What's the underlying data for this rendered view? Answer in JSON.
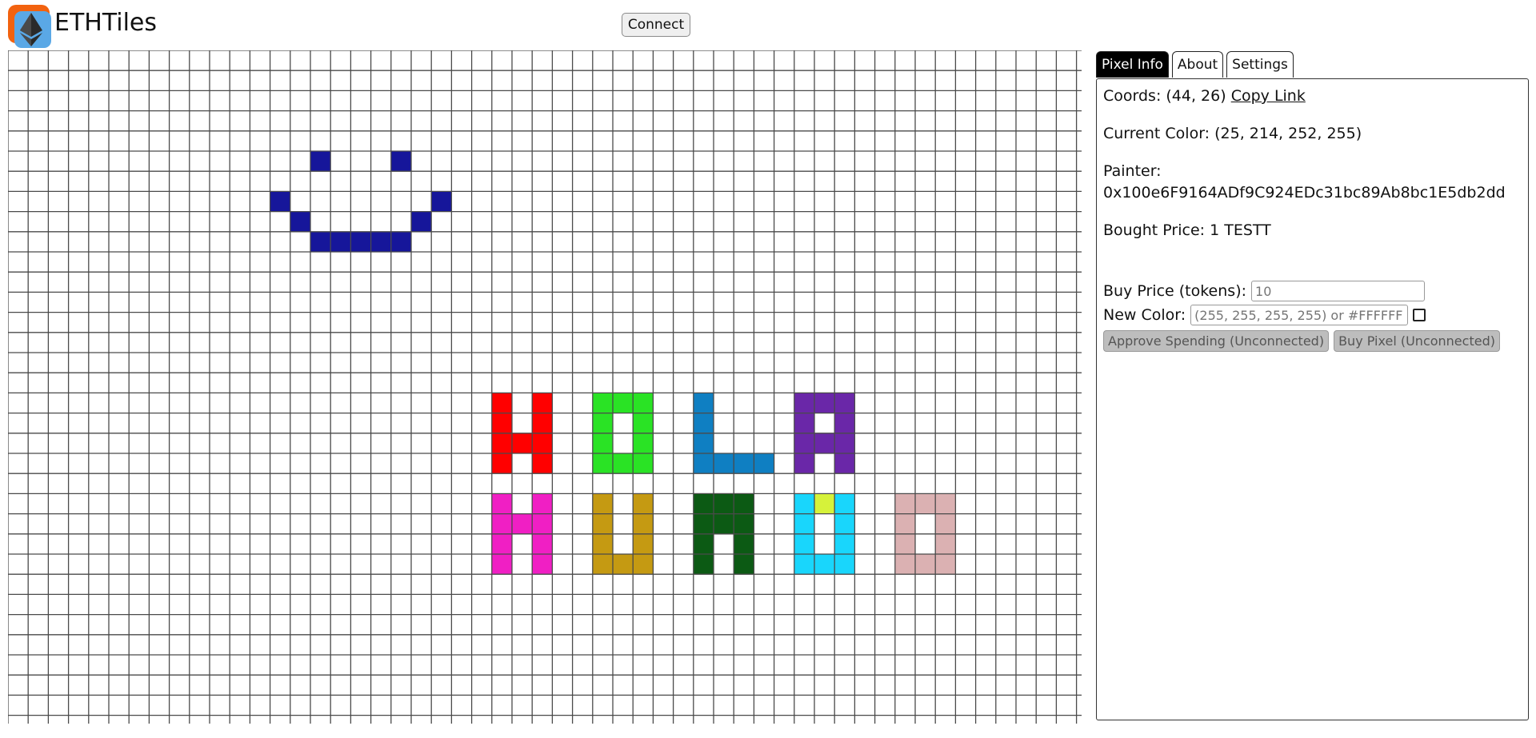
{
  "app": {
    "title": "ETHTiles"
  },
  "header": {
    "connect_label": "Connect"
  },
  "tabs": [
    {
      "label": "Pixel Info",
      "active": true
    },
    {
      "label": "About",
      "active": false
    },
    {
      "label": "Settings",
      "active": false
    }
  ],
  "pixel_info": {
    "coords_label": "Coords: (44, 26)",
    "copy_link_label": "Copy Link",
    "current_color": "Current Color: (25, 214, 252, 255)",
    "painter_label": "Painter:",
    "painter_address": "0x100e6F9164ADf9C924EDc31bc89Ab8bc1E5db2dd",
    "bought_price": "Bought Price: 1 TESTT"
  },
  "buy_form": {
    "price_label": "Buy Price (tokens):",
    "price_placeholder": "10",
    "color_label": "New Color:",
    "color_placeholder": "(255, 255, 255, 255) or #FFFFFFFF",
    "approve_label": "Approve Spending (Unconnected)",
    "buy_label": "Buy Pixel (Unconnected)"
  },
  "canvas": {
    "columns": 54,
    "rows": 34,
    "painted_pixels": [
      {
        "x": 15,
        "y": 5,
        "color": "#16169a"
      },
      {
        "x": 19,
        "y": 5,
        "color": "#16169a"
      },
      {
        "x": 13,
        "y": 7,
        "color": "#16169a"
      },
      {
        "x": 21,
        "y": 7,
        "color": "#16169a"
      },
      {
        "x": 14,
        "y": 8,
        "color": "#16169a"
      },
      {
        "x": 20,
        "y": 8,
        "color": "#16169a"
      },
      {
        "x": 15,
        "y": 9,
        "color": "#16169a"
      },
      {
        "x": 16,
        "y": 9,
        "color": "#16169a"
      },
      {
        "x": 17,
        "y": 9,
        "color": "#16169a"
      },
      {
        "x": 18,
        "y": 9,
        "color": "#16169a"
      },
      {
        "x": 19,
        "y": 9,
        "color": "#16169a"
      },
      {
        "x": 24,
        "y": 17,
        "color": "#ff0000"
      },
      {
        "x": 26,
        "y": 17,
        "color": "#ff0000"
      },
      {
        "x": 24,
        "y": 18,
        "color": "#ff0000"
      },
      {
        "x": 26,
        "y": 18,
        "color": "#ff0000"
      },
      {
        "x": 24,
        "y": 19,
        "color": "#ff0000"
      },
      {
        "x": 25,
        "y": 19,
        "color": "#ff0000"
      },
      {
        "x": 26,
        "y": 19,
        "color": "#ff0000"
      },
      {
        "x": 24,
        "y": 20,
        "color": "#ff0000"
      },
      {
        "x": 26,
        "y": 20,
        "color": "#ff0000"
      },
      {
        "x": 29,
        "y": 17,
        "color": "#2ae325"
      },
      {
        "x": 30,
        "y": 17,
        "color": "#2ae325"
      },
      {
        "x": 31,
        "y": 17,
        "color": "#2ae325"
      },
      {
        "x": 29,
        "y": 18,
        "color": "#2ae325"
      },
      {
        "x": 31,
        "y": 18,
        "color": "#2ae325"
      },
      {
        "x": 29,
        "y": 19,
        "color": "#2ae325"
      },
      {
        "x": 31,
        "y": 19,
        "color": "#2ae325"
      },
      {
        "x": 29,
        "y": 20,
        "color": "#2ae325"
      },
      {
        "x": 30,
        "y": 20,
        "color": "#2ae325"
      },
      {
        "x": 31,
        "y": 20,
        "color": "#2ae325"
      },
      {
        "x": 34,
        "y": 17,
        "color": "#0f7fc2"
      },
      {
        "x": 34,
        "y": 18,
        "color": "#0f7fc2"
      },
      {
        "x": 34,
        "y": 19,
        "color": "#0f7fc2"
      },
      {
        "x": 34,
        "y": 20,
        "color": "#0f7fc2"
      },
      {
        "x": 35,
        "y": 20,
        "color": "#0f7fc2"
      },
      {
        "x": 36,
        "y": 20,
        "color": "#0f7fc2"
      },
      {
        "x": 37,
        "y": 20,
        "color": "#0f7fc2"
      },
      {
        "x": 39,
        "y": 17,
        "color": "#6a27a8"
      },
      {
        "x": 40,
        "y": 17,
        "color": "#6a27a8"
      },
      {
        "x": 41,
        "y": 17,
        "color": "#6a27a8"
      },
      {
        "x": 39,
        "y": 18,
        "color": "#6a27a8"
      },
      {
        "x": 41,
        "y": 18,
        "color": "#6a27a8"
      },
      {
        "x": 39,
        "y": 19,
        "color": "#6a27a8"
      },
      {
        "x": 40,
        "y": 19,
        "color": "#6a27a8"
      },
      {
        "x": 41,
        "y": 19,
        "color": "#6a27a8"
      },
      {
        "x": 39,
        "y": 20,
        "color": "#6a27a8"
      },
      {
        "x": 41,
        "y": 20,
        "color": "#6a27a8"
      },
      {
        "x": 24,
        "y": 22,
        "color": "#f01fc4"
      },
      {
        "x": 26,
        "y": 22,
        "color": "#f01fc4"
      },
      {
        "x": 24,
        "y": 23,
        "color": "#f01fc4"
      },
      {
        "x": 25,
        "y": 23,
        "color": "#f01fc4"
      },
      {
        "x": 26,
        "y": 23,
        "color": "#f01fc4"
      },
      {
        "x": 24,
        "y": 24,
        "color": "#f01fc4"
      },
      {
        "x": 26,
        "y": 24,
        "color": "#f01fc4"
      },
      {
        "x": 24,
        "y": 25,
        "color": "#f01fc4"
      },
      {
        "x": 26,
        "y": 25,
        "color": "#f01fc4"
      },
      {
        "x": 29,
        "y": 22,
        "color": "#c59a12"
      },
      {
        "x": 31,
        "y": 22,
        "color": "#c59a12"
      },
      {
        "x": 29,
        "y": 23,
        "color": "#c59a12"
      },
      {
        "x": 31,
        "y": 23,
        "color": "#c59a12"
      },
      {
        "x": 29,
        "y": 24,
        "color": "#c59a12"
      },
      {
        "x": 31,
        "y": 24,
        "color": "#c59a12"
      },
      {
        "x": 29,
        "y": 25,
        "color": "#c59a12"
      },
      {
        "x": 30,
        "y": 25,
        "color": "#c59a12"
      },
      {
        "x": 31,
        "y": 25,
        "color": "#c59a12"
      },
      {
        "x": 34,
        "y": 22,
        "color": "#0c5a14"
      },
      {
        "x": 35,
        "y": 22,
        "color": "#0c5a14"
      },
      {
        "x": 36,
        "y": 22,
        "color": "#0c5a14"
      },
      {
        "x": 34,
        "y": 23,
        "color": "#0c5a14"
      },
      {
        "x": 35,
        "y": 23,
        "color": "#0c5a14"
      },
      {
        "x": 36,
        "y": 23,
        "color": "#0c5a14"
      },
      {
        "x": 34,
        "y": 24,
        "color": "#0c5a14"
      },
      {
        "x": 36,
        "y": 24,
        "color": "#0c5a14"
      },
      {
        "x": 34,
        "y": 25,
        "color": "#0c5a14"
      },
      {
        "x": 36,
        "y": 25,
        "color": "#0c5a14"
      },
      {
        "x": 39,
        "y": 22,
        "color": "#19d6fc"
      },
      {
        "x": 40,
        "y": 22,
        "color": "#d6f23a"
      },
      {
        "x": 41,
        "y": 22,
        "color": "#19d6fc"
      },
      {
        "x": 39,
        "y": 23,
        "color": "#19d6fc"
      },
      {
        "x": 41,
        "y": 23,
        "color": "#19d6fc"
      },
      {
        "x": 39,
        "y": 24,
        "color": "#19d6fc"
      },
      {
        "x": 41,
        "y": 24,
        "color": "#19d6fc"
      },
      {
        "x": 39,
        "y": 25,
        "color": "#19d6fc"
      },
      {
        "x": 40,
        "y": 25,
        "color": "#19d6fc"
      },
      {
        "x": 41,
        "y": 25,
        "color": "#19d6fc"
      },
      {
        "x": 44,
        "y": 22,
        "color": "#dbb1b2"
      },
      {
        "x": 45,
        "y": 22,
        "color": "#dbb1b2"
      },
      {
        "x": 46,
        "y": 22,
        "color": "#dbb1b2"
      },
      {
        "x": 44,
        "y": 23,
        "color": "#dbb1b2"
      },
      {
        "x": 46,
        "y": 23,
        "color": "#dbb1b2"
      },
      {
        "x": 44,
        "y": 24,
        "color": "#dbb1b2"
      },
      {
        "x": 46,
        "y": 24,
        "color": "#dbb1b2"
      },
      {
        "x": 44,
        "y": 25,
        "color": "#dbb1b2"
      },
      {
        "x": 45,
        "y": 25,
        "color": "#dbb1b2"
      },
      {
        "x": 46,
        "y": 25,
        "color": "#dbb1b2"
      }
    ]
  }
}
